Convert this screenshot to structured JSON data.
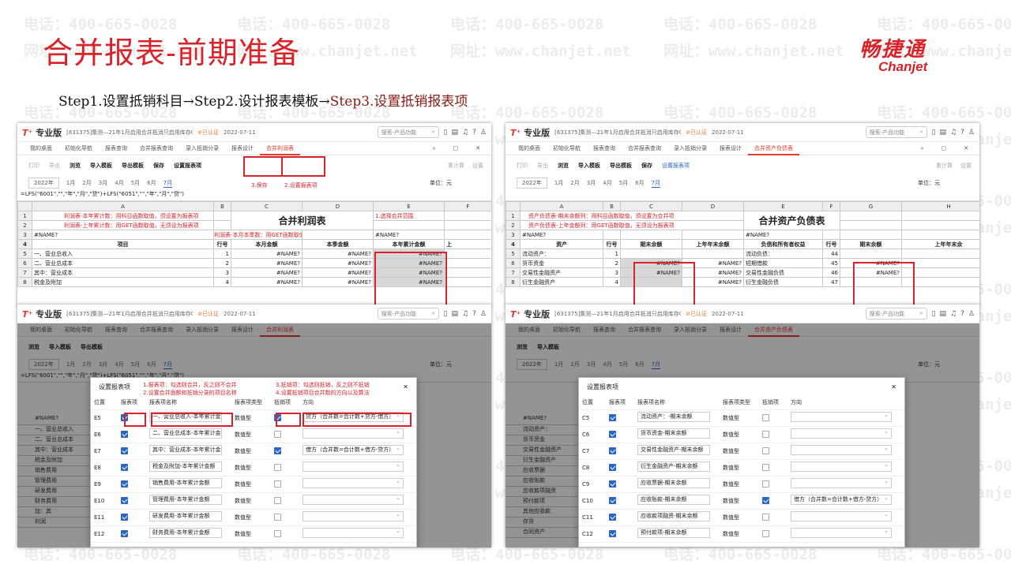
{
  "slide": {
    "title": "合并报表-前期准备",
    "logo_cn": "畅捷通",
    "logo_en": "Chanjet",
    "steps": {
      "s1": "Step1.设置抵销科目",
      "arrow": "→",
      "s2": "Step2.设计报表模板",
      "s3": "Step3.设置抵销报表项"
    },
    "watermark_phone": "电话：400-665-0028",
    "watermark_url": "网址：www.chanjet.net"
  },
  "app": {
    "brand_t": "T⁺",
    "brand": "专业版",
    "company": "[631375]集测—21年1月启用合并抵消只启用库存07...",
    "cert": "⊘已认证",
    "date": "2022-07-11",
    "search_placeholder": "搜索-产品功能",
    "tabs": [
      "我的桌面",
      "初始化导航",
      "报表查询",
      "合并报表查询",
      "录入抵销分录",
      "报表设计"
    ],
    "tab_profit": "合并利润表",
    "tab_balance": "合并资产负债表",
    "toolbar": {
      "print": "打印",
      "export": "导出",
      "browse": "浏览",
      "import_tpl": "导入模板",
      "export_tpl": "导出模板",
      "save": "保存",
      "set_item": "设置报表项",
      "recalc": "重计算",
      "settings": "设置"
    },
    "year": "2022年",
    "months": [
      "1月",
      "2月",
      "3月",
      "4月",
      "5月",
      "6月",
      "7月"
    ],
    "unit": "单位：元"
  },
  "profit": {
    "formula": "=LFS(\"6001\",\"\",\"年\",\"月\",\"贷\")+LFS(\"6051\",\"\",\"年\",\"月\",\"贷\")",
    "cols": [
      "",
      "A",
      "B",
      "C",
      "D",
      "E",
      "F"
    ],
    "title": "合并利润表",
    "notes": [
      "利润表-本年累计数：用科目函数取值，须设置为报表项",
      "利润表-上年累计数：用GET函数取值，无须设为报表项",
      "利润表-本月本季数：用GET函数取值，无须设为报表项"
    ],
    "name_err": "#NAME?",
    "heads": [
      "项目",
      "行号",
      "本月金额",
      "本季金额",
      "本年累计金额",
      "上"
    ],
    "rows": [
      {
        "n": "5",
        "item": "一、营业总收入",
        "no": "1"
      },
      {
        "n": "6",
        "item": "二、营业总成本",
        "no": "2"
      },
      {
        "n": "7",
        "item": "    其中：营业成本",
        "no": "3"
      },
      {
        "n": "8",
        "item": "        税金及附加",
        "no": "4"
      }
    ],
    "ann_range": "1.选择合并范围",
    "ann_save": "3.保存",
    "ann_set": "2.设置报表项"
  },
  "balance": {
    "cols": [
      "",
      "A",
      "B",
      "C",
      "D",
      "E",
      "F",
      "G",
      "H"
    ],
    "title": "合并资产负债表",
    "notes": [
      "资产负债表-期末余额列：用科目函数取值，须设置为合并项",
      "资产负债表-上年金额列：用GET函数取值，无须设为报表项"
    ],
    "heads": [
      "资产",
      "行号",
      "期末余额",
      "上年年末余额",
      "负债和所有者权益",
      "行号",
      "期末余额",
      "上年年末余"
    ],
    "rows": [
      {
        "n": "5",
        "a": "流动资产：",
        "b": "1",
        "e": "流动负债：",
        "f": "44"
      },
      {
        "n": "6",
        "a": "  货币资金",
        "b": "2",
        "e": "短期借款",
        "f": "45"
      },
      {
        "n": "7",
        "a": "  交易性金融资产",
        "b": "3",
        "e": "交易性金融负债",
        "f": "46"
      },
      {
        "n": "8",
        "a": "  衍生金融资产",
        "b": "4",
        "e": "衍生金融负债",
        "f": "47"
      }
    ],
    "extra": {
      "he": "合",
      "dan": "单",
      "na": "#N"
    }
  },
  "modal1": {
    "title": "设置报表项",
    "ann1": "1.报表项：勾选则合并，反之则不合并",
    "ann2": "2.设置合并面额和抵销分录的项目名称",
    "ann3": "3.抵销项：勾选则抵销，反之则不抵销",
    "ann4": "4.设置抵销项目合并数的方向以及算法",
    "cols": [
      "位置",
      "报表项",
      "报表项名称",
      "报表项类型",
      "抵销项",
      "方向"
    ],
    "rows": [
      {
        "pos": "E5",
        "name": "一、营业总收入-本年累计金额",
        "type": "数值型",
        "dir": "贷方（合并数=合计数+贷方-借方）"
      },
      {
        "pos": "E6",
        "name": "二、营业总成本-本年累计金额",
        "type": "数值型",
        "dir": ""
      },
      {
        "pos": "E7",
        "name": "其中：营业成本-本年累计金额",
        "type": "数值型",
        "dir": "借方（合并数=合计数+借方-贷方）"
      },
      {
        "pos": "E8",
        "name": "税金及附加-本年累计金额",
        "type": "数值型",
        "dir": ""
      },
      {
        "pos": "E9",
        "name": "销售费用-本年累计金额",
        "type": "数值型",
        "dir": ""
      },
      {
        "pos": "E10",
        "name": "管理费用-本年累计金额",
        "type": "数值型",
        "dir": ""
      },
      {
        "pos": "E11",
        "name": "研发费用-本年累计金额",
        "type": "数值型",
        "dir": ""
      },
      {
        "pos": "E12",
        "name": "财务费用-本年累计金额",
        "type": "数值型",
        "dir": ""
      }
    ],
    "bg_rows": [
      "#NAME?",
      "一、营业总收入",
      "二、营业总成本",
      "其中：营业成本",
      "税金及附加",
      "销售费用",
      "管理费用",
      "研发费用",
      "财务费用",
      "加：其",
      "利润"
    ]
  },
  "modal2": {
    "title": "设置报表项",
    "cols": [
      "位置",
      "报表项",
      "报表项名称",
      "报表项类型",
      "抵销项",
      "方向"
    ],
    "rows": [
      {
        "pos": "C5",
        "name": "流动资产：-期末余额",
        "type": "数值型",
        "dir": ""
      },
      {
        "pos": "C6",
        "name": "货币资金-期末余额",
        "type": "数值型",
        "dir": ""
      },
      {
        "pos": "C7",
        "name": "交易性金融资产-期末余额",
        "type": "数值型",
        "dir": ""
      },
      {
        "pos": "C8",
        "name": "衍生金融资产-期末余额",
        "type": "数值型",
        "dir": ""
      },
      {
        "pos": "C9",
        "name": "应收票据-期末余额",
        "type": "数值型",
        "dir": ""
      },
      {
        "pos": "C10",
        "name": "应收账款-期末余额",
        "type": "数值型",
        "dir": "借方（合并数=合计数+借方-贷方）"
      },
      {
        "pos": "C11",
        "name": "应收款项融资-期末余额",
        "type": "数值型",
        "dir": ""
      },
      {
        "pos": "C12",
        "name": "预付款项-期末余额",
        "type": "数值型",
        "dir": ""
      }
    ],
    "bg_rows": [
      "#NAME?",
      "流动资产：",
      "货币资金",
      "交易性金融资产",
      "衍生金融资产",
      "应收票据",
      "应收账款",
      "应收款项融资",
      "预付款项",
      "其他应收款",
      "存货",
      "合同资产"
    ]
  }
}
